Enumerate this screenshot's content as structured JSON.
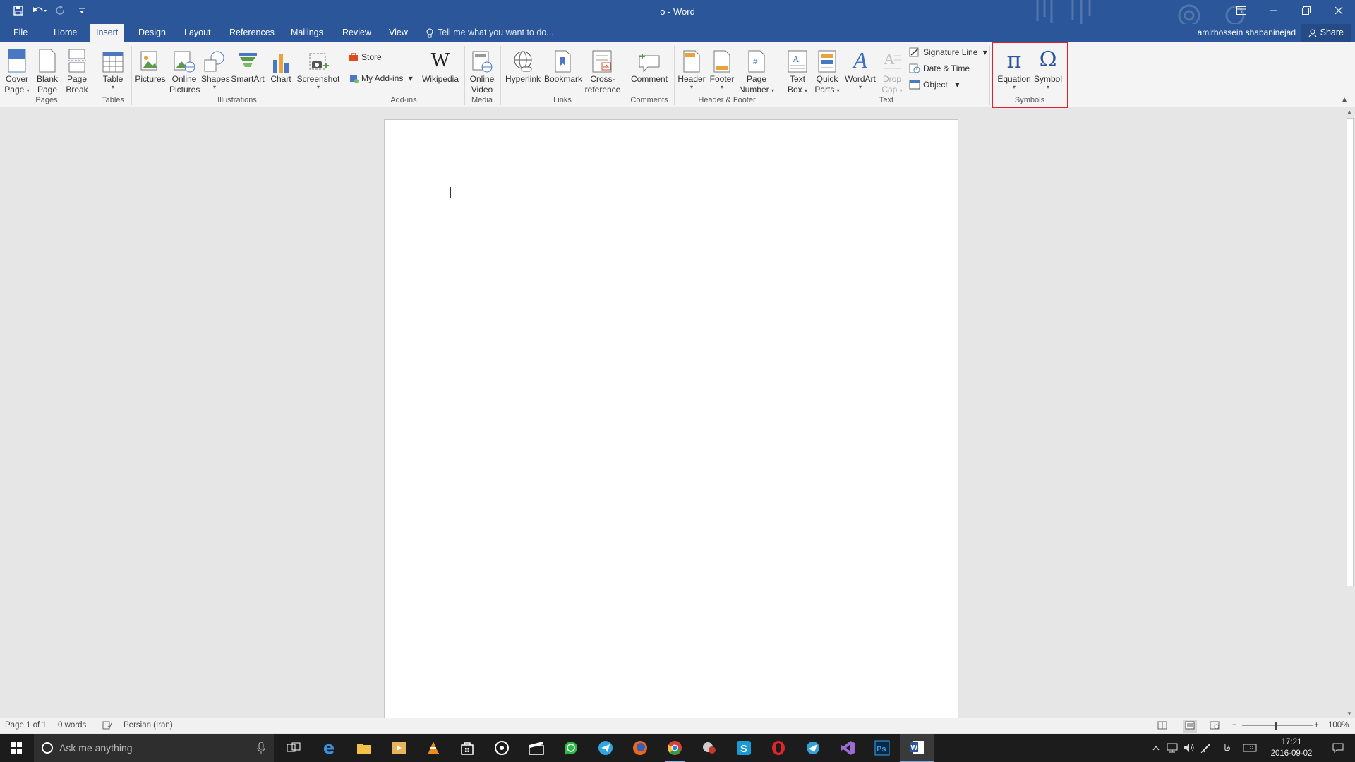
{
  "window": {
    "title": "o - Word",
    "controls": [
      "ribbon-display-icon",
      "minimize-icon",
      "restore-icon",
      "close-icon"
    ]
  },
  "quick_access": [
    "save-icon",
    "undo-icon",
    "redo-icon",
    "customize-icon"
  ],
  "tabs": [
    "File",
    "Home",
    "Insert",
    "Design",
    "Layout",
    "References",
    "Mailings",
    "Review",
    "View"
  ],
  "active_tab": "Insert",
  "tell_me": "Tell me what you want to do...",
  "user": {
    "name": "amirhossein shabaninejad",
    "share": "Share"
  },
  "ribbon": {
    "pages": {
      "group": "Pages",
      "cover": [
        "Cover",
        "Page"
      ],
      "blank": [
        "Blank",
        "Page"
      ],
      "break": [
        "Page",
        "Break"
      ]
    },
    "tables": {
      "group": "Tables",
      "table": "Table"
    },
    "illustrations": {
      "group": "Illustrations",
      "pictures": "Pictures",
      "online_pictures": [
        "Online",
        "Pictures"
      ],
      "shapes": "Shapes",
      "smartart": "SmartArt",
      "chart": "Chart",
      "screenshot": "Screenshot"
    },
    "addins": {
      "group": "Add-ins",
      "store": "Store",
      "my_addins": "My Add-ins",
      "wikipedia": "Wikipedia"
    },
    "media": {
      "group": "Media",
      "online_video": [
        "Online",
        "Video"
      ]
    },
    "links": {
      "group": "Links",
      "hyperlink": "Hyperlink",
      "bookmark": "Bookmark",
      "cross_reference": [
        "Cross-",
        "reference"
      ]
    },
    "comments": {
      "group": "Comments",
      "comment": "Comment"
    },
    "header_footer": {
      "group": "Header & Footer",
      "header": "Header",
      "footer": "Footer",
      "page_number": [
        "Page",
        "Number"
      ]
    },
    "text": {
      "group": "Text",
      "text_box": [
        "Text",
        "Box"
      ],
      "quick_parts": [
        "Quick",
        "Parts"
      ],
      "wordart": "WordArt",
      "drop_cap": [
        "Drop",
        "Cap"
      ],
      "signature_line": "Signature Line",
      "date_time": "Date & Time",
      "object": "Object"
    },
    "symbols": {
      "group": "Symbols",
      "equation": "Equation",
      "symbol": "Symbol"
    }
  },
  "status": {
    "page": "Page 1 of 1",
    "words": "0 words",
    "language": "Persian (Iran)",
    "zoom": "100%"
  },
  "taskbar": {
    "search_placeholder": "Ask me anything",
    "apps": [
      "task-view-icon",
      "edge-icon",
      "file-explorer-icon",
      "media-player-icon",
      "vlc-icon",
      "store-icon",
      "groove-icon",
      "movies-icon",
      "whatsapp-icon",
      "telegram-icon",
      "firefox-icon",
      "chrome-icon",
      "app-icon",
      "skype-icon",
      "opera-icon",
      "app-icon-2",
      "visual-studio-icon",
      "photoshop-icon",
      "word-icon"
    ],
    "input_lang": "فا",
    "time": "17:21",
    "date": "2016-09-02"
  },
  "colors": {
    "title_bar": "#2b579a",
    "ribbon": "#f4f4f4",
    "highlight": "#e0202e",
    "taskbar": "#1c1c1c"
  }
}
